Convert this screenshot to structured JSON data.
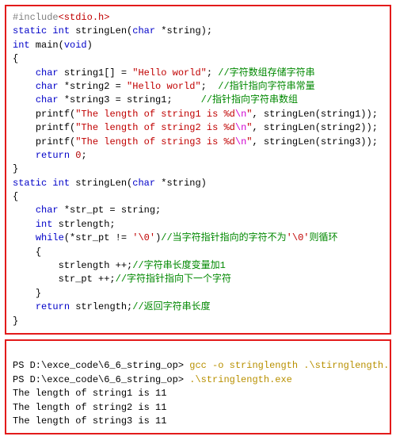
{
  "code": {
    "l1_pre": "#include",
    "l1_hdr": "<stdio.h>",
    "l2_kw1": "static",
    "l2_kw2": "int",
    "l2_fn": " stringLen(",
    "l2_kw3": "char",
    "l2_arg": " *string);",
    "l3_kw1": "int",
    "l3_fn": " main(",
    "l3_kw2": "void",
    "l3_cl": ")",
    "l4": "{",
    "l5_ind": "    ",
    "l5_kw": "char",
    "l5_var": " string1[] = ",
    "l5_str": "\"Hello world\"",
    "l5_sc": "; ",
    "l5_cmt": "//字符数组存储字符串",
    "l6_ind": "    ",
    "l6_kw": "char",
    "l6_var": " *string2 = ",
    "l6_str": "\"Hello world\"",
    "l6_sc": ";  ",
    "l6_cmt": "//指针指向字符串常量",
    "l7_ind": "    ",
    "l7_kw": "char",
    "l7_var": " *string3 = string1;     ",
    "l7_cmt": "//指针指向字符串数组",
    "l8_ind": "    ",
    "l8_fn": "printf(",
    "l8_str": "\"The length of string1 is %d",
    "l8_esc": "\\n",
    "l8_strend": "\"",
    "l8_args": ", stringLen(string1));",
    "l9_ind": "    ",
    "l9_fn": "printf(",
    "l9_str": "\"The length of string2 is %d",
    "l9_esc": "\\n",
    "l9_strend": "\"",
    "l9_args": ", stringLen(string2));",
    "l10_ind": "    ",
    "l10_fn": "printf(",
    "l10_str": "\"The length of string3 is %d",
    "l10_esc": "\\n",
    "l10_strend": "\"",
    "l10_args": ", stringLen(string3));",
    "l11_ind": "    ",
    "l11_kw": "return",
    "l11_sp": " ",
    "l11_num": "0",
    "l11_sc": ";",
    "l12": "}",
    "l13_kw1": "static",
    "l13_kw2": "int",
    "l13_fn": " stringLen(",
    "l13_kw3": "char",
    "l13_arg": " *string)",
    "l14": "{",
    "l15_ind": "    ",
    "l15_kw": "char",
    "l15_var": " *str_pt = string;",
    "l16_ind": "    ",
    "l16_kw": "int",
    "l16_var": " strlength;",
    "l17_ind": "    ",
    "l17_kw": "while",
    "l17_a": "(*str_pt != ",
    "l17_chr": "'\\0'",
    "l17_b": ")",
    "l17_cmt_a": "//当字符指针指向的字符不为",
    "l17_chr2": "'\\0'",
    "l17_cmt_b": "则循环",
    "l18_ind": "    ",
    "l18": "{",
    "l19_ind": "        ",
    "l19_st": "strlength ++;",
    "l19_cmt": "//字符串长度变量加1",
    "l20_ind": "        ",
    "l20_st": "str_pt ++;",
    "l20_cmt": "//字符指针指向下一个字符",
    "l21_ind": "    ",
    "l21": "}",
    "l22_ind": "    ",
    "l22_kw": "return",
    "l22_var": " strlength;",
    "l22_cmt": "//返回字符串长度",
    "l23": "}"
  },
  "term": {
    "p1_prompt": "PS D:\\exce_code\\6_6_string_op> ",
    "p1_cmd": "gcc -o stringlength .\\stirnglength.c",
    "p2_prompt": "PS D:\\exce_code\\6_6_string_op> ",
    "p2_cmd": ".\\stringlength.exe",
    "out1": "The length of string1 is 11",
    "out2": "The length of string2 is 11",
    "out3": "The length of string3 is 11"
  }
}
